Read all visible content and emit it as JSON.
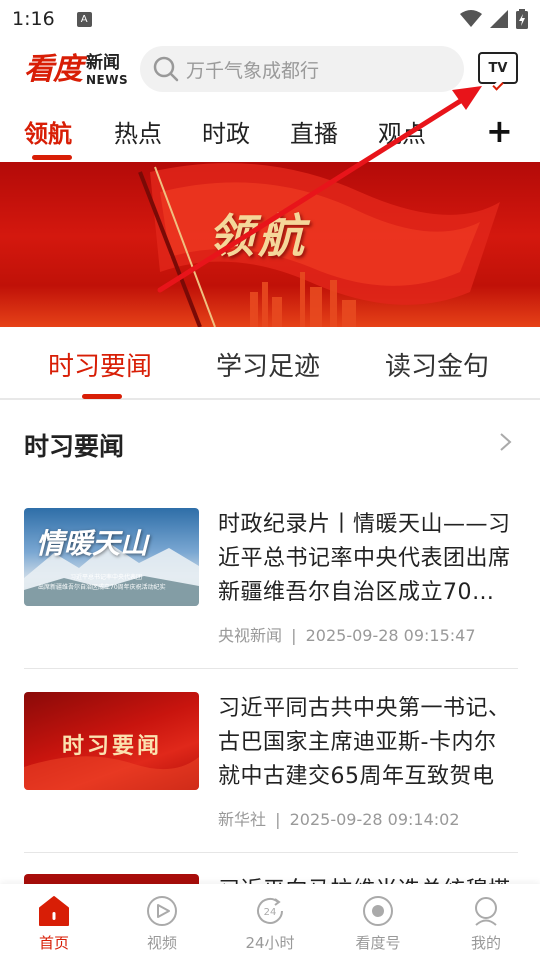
{
  "status_bar": {
    "time": "1:16",
    "notification_letter": "A"
  },
  "header": {
    "logo_main": "看度",
    "logo_sub": "新闻",
    "logo_news": "NEWS",
    "search_placeholder": "万千气象成都行",
    "tv_label": "TV"
  },
  "channels": {
    "items": [
      "领航",
      "热点",
      "时政",
      "直播",
      "观点"
    ],
    "active": "领航",
    "plus_label": "+"
  },
  "banner": {
    "title": "领航"
  },
  "sub_tabs": {
    "items": [
      "时习要闻",
      "学习足迹",
      "读习金句"
    ],
    "active": "时习要闻"
  },
  "section": {
    "title": "时习要闻"
  },
  "news": [
    {
      "title": "时政纪录片丨情暖天山——习近平总书记率中央代表团出席新疆维吾尔自治区成立70…",
      "source": "央视新闻",
      "time": "2025-09-28 09:15:47",
      "thumb_title": "情暖天山",
      "thumb_caption_1": "习近平总书记率中央代表团",
      "thumb_caption_2": "出席新疆维吾尔自治区成立70周年庆祝活动纪实"
    },
    {
      "title": "习近平同古共中央第一书记、古巴国家主席迪亚斯-卡内尔就中古建交65周年互致贺电",
      "source": "新华社",
      "time": "2025-09-28 09:14:02",
      "thumb_title": "时习要闻"
    },
    {
      "title": "习近平向马拉维当选总统穆塔",
      "source": "",
      "time": ""
    }
  ],
  "meta_separator": "|",
  "bottom_nav": {
    "items": [
      {
        "label": "首页",
        "icon": "home-icon"
      },
      {
        "label": "视频",
        "icon": "video-icon"
      },
      {
        "label": "24小时",
        "icon": "24h-icon"
      },
      {
        "label": "看度号",
        "icon": "kandu-icon"
      },
      {
        "label": "我的",
        "icon": "profile-icon"
      }
    ],
    "active": "首页"
  },
  "colors": {
    "brand_red": "#d81e06",
    "text": "#222222",
    "muted": "#999999"
  }
}
